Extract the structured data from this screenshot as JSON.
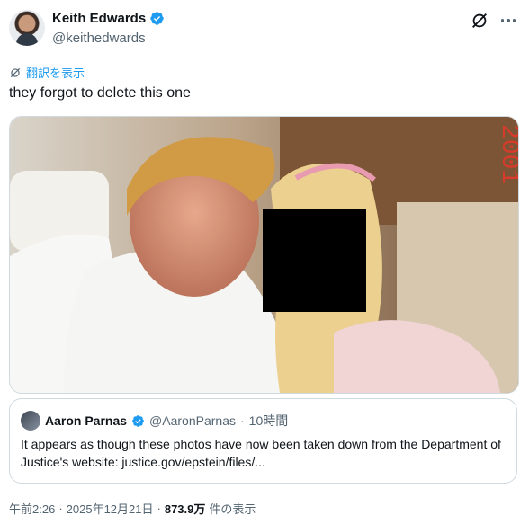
{
  "author": {
    "name": "Keith Edwards",
    "handle": "@keithedwards"
  },
  "translate_label": "翻訳を表示",
  "tweet_text": "they forgot to delete this one",
  "media": {
    "description_visible_overlay": "2001"
  },
  "quote": {
    "name": "Aaron Parnas",
    "handle": "@AaronParnas",
    "separator": "·",
    "time": "10時間",
    "text": "It appears as though these photos have now been taken down from the Department of Justice's website: justice.gov/epstein/files/..."
  },
  "footer": {
    "time": "午前2:26",
    "separator1": "·",
    "date": "2025年12月21日",
    "separator2": "·",
    "views_count": "873.9万",
    "views_label": "件の表示"
  },
  "colors": {
    "accent": "#1d9bf0",
    "muted": "#536471",
    "text": "#0f1419"
  }
}
